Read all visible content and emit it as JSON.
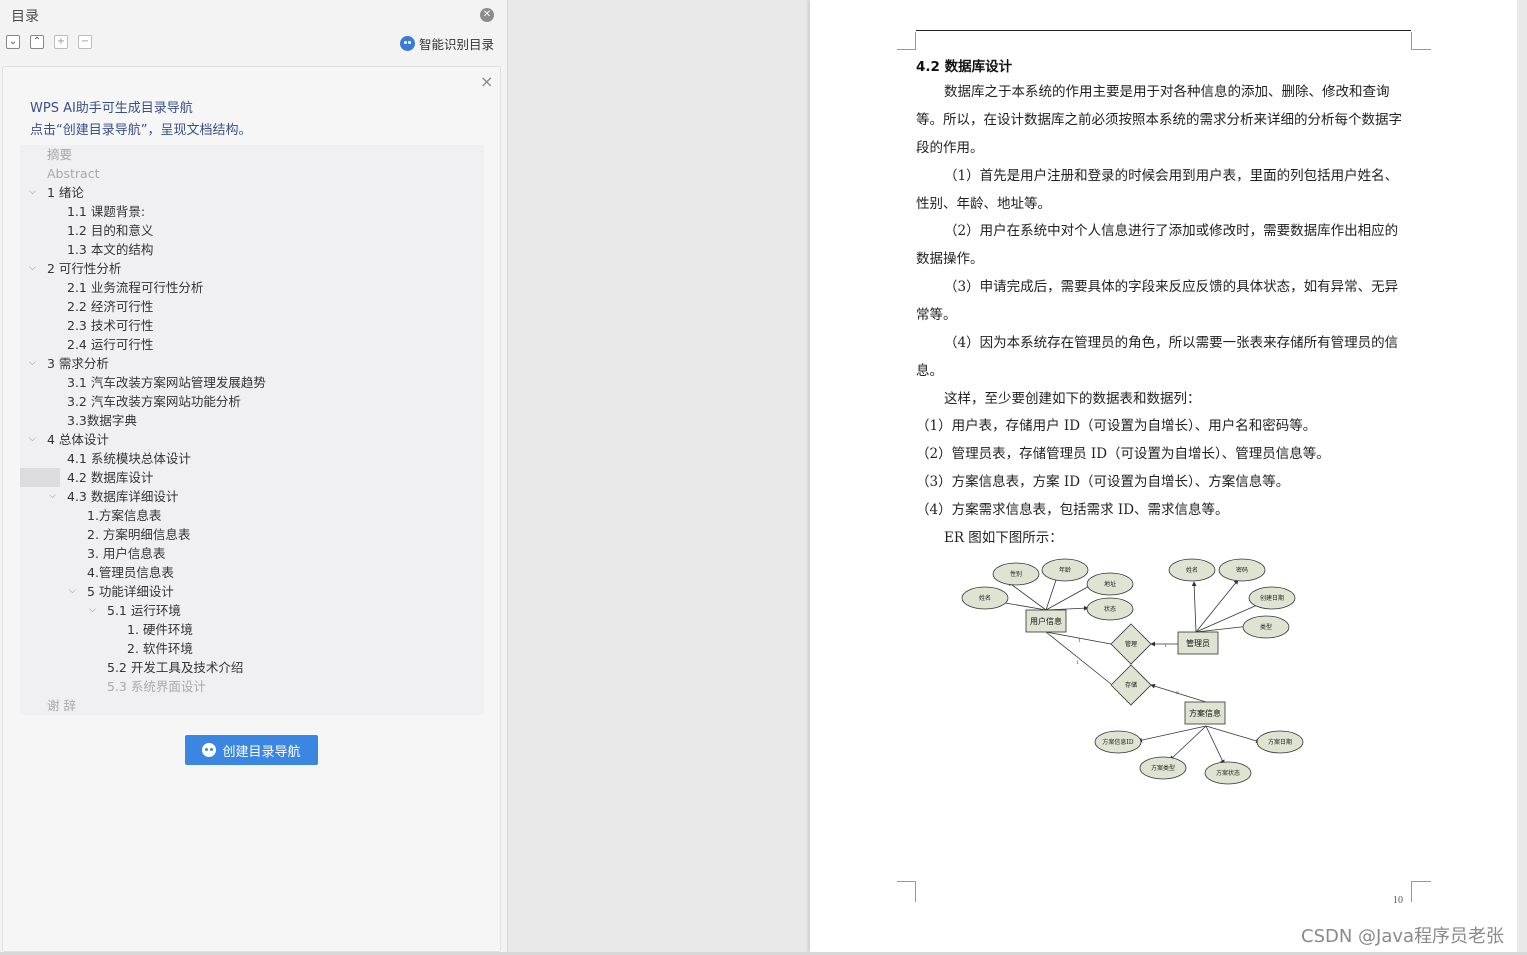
{
  "toc_panel": {
    "title": "目录",
    "smart_toc_label": "智能识别目录",
    "ai_card": {
      "message_line1": "WPS AI助手可生成目录导航",
      "message_line2": "点击“创建目录导航”，呈现文档结构。",
      "create_button_label": "创建目录导航"
    },
    "items": [
      {
        "label": "摘要",
        "level": 1,
        "dim": true
      },
      {
        "label": "Abstract",
        "level": 1,
        "dim": true
      },
      {
        "label": "1 绪论",
        "level": 1,
        "chevron": true
      },
      {
        "label": "1.1 课题背景:",
        "level": 2
      },
      {
        "label": "1.2 目的和意义",
        "level": 2
      },
      {
        "label": "1.3 本文的结构",
        "level": 2
      },
      {
        "label": "2  可行性分析",
        "level": 1,
        "chevron": true
      },
      {
        "label": "2.1  业务流程可行性分析",
        "level": 2
      },
      {
        "label": "2.2 经济可行性",
        "level": 2
      },
      {
        "label": "2.3 技术可行性",
        "level": 2
      },
      {
        "label": "2.4 运行可行性",
        "level": 2
      },
      {
        "label": "3 需求分析",
        "level": 1,
        "chevron": true
      },
      {
        "label": "3.1 汽车改装方案网站管理发展趋势",
        "level": 2
      },
      {
        "label": "3.2 汽车改装方案网站功能分析",
        "level": 2
      },
      {
        "label": "3.3数据字典",
        "level": 2
      },
      {
        "label": "4 总体设计",
        "level": 1,
        "chevron": true
      },
      {
        "label": "4.1 系统模块总体设计",
        "level": 2
      },
      {
        "label": "4.2 数据库设计",
        "level": 2,
        "selected": true
      },
      {
        "label": "4.3 数据库详细设计",
        "level": 2,
        "chevron": true
      },
      {
        "label": "1.方案信息表",
        "level": 3
      },
      {
        "label": "2.  方案明细信息表",
        "level": 3
      },
      {
        "label": "3.  用户信息表",
        "level": 3
      },
      {
        "label": "4.管理员信息表",
        "level": 3
      },
      {
        "label": "5 功能详细设计",
        "level": 3,
        "chevron": true
      },
      {
        "label": "5.1 运行环境",
        "level": 4,
        "chevron": true
      },
      {
        "label": "1.  硬件环境",
        "level": 5
      },
      {
        "label": "2.  软件环境",
        "level": 5
      },
      {
        "label": "5.2 开发工具及技术介绍",
        "level": 4
      },
      {
        "label": "5.3 系统界面设计",
        "level": 4,
        "dim": true
      },
      {
        "label": "谢  辞",
        "level": 1,
        "dim": true
      }
    ]
  },
  "document": {
    "section_title": "4.2  数据库设计",
    "paragraphs": [
      "数据库之于本系统的作用主要是用于对各种信息的添加、删除、修改和查询等。所以，在设计数据库之前必须按照本系统的需求分析来详细的分析每个数据字段的作用。",
      "（1）首先是用户注册和登录的时候会用到用户表，里面的列包括用户姓名、性别、年龄、地址等。",
      "（2）用户在系统中对个人信息进行了添加或修改时，需要数据库作出相应的数据操作。",
      "（3）申请完成后，需要具体的字段来反应反馈的具体状态，如有异常、无异常等。",
      "（4）因为本系统存在管理员的角色，所以需要一张表来存储所有管理员的信息。",
      "这样，至少要创建如下的数据表和数据列：",
      "（1）用户表，存储用户 ID（可设置为自增长）、用户名和密码等。",
      "（2）管理员表，存储管理员 ID（可设置为自增长）、管理员信息等。",
      "（3）方案信息表，方案 ID（可设置为自增长）、方案信息等。",
      "（4）方案需求信息表，包括需求 ID、需求信息等。",
      "ER 图如下图所示："
    ],
    "page_number": "10",
    "er_diagram": {
      "entities": [
        "用户信息",
        "管理员",
        "方案信息"
      ],
      "relations": [
        "管理",
        "存储"
      ],
      "attributes_user": [
        "性别",
        "年龄",
        "姓名",
        "地址",
        "状态"
      ],
      "attributes_admin": [
        "姓名",
        "密码",
        "创建日期",
        "类型"
      ],
      "attributes_plan": [
        "方案信息ID",
        "方案类型",
        "方案状态",
        "方案日期"
      ],
      "cardinalities": [
        "1",
        "1",
        "1",
        "n"
      ]
    }
  },
  "watermark": "CSDN @Java程序员老张"
}
